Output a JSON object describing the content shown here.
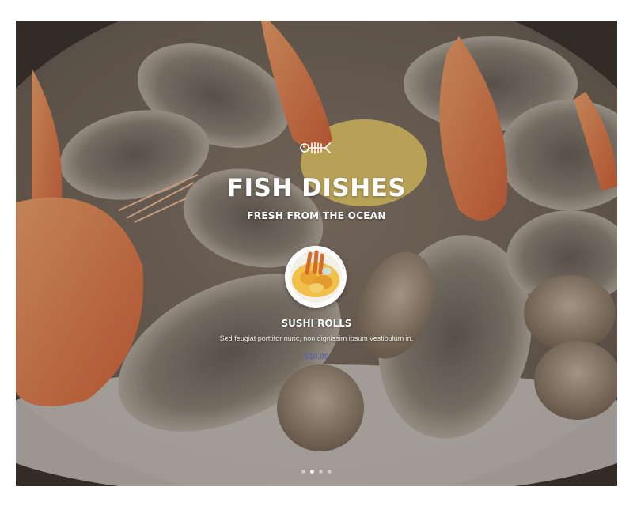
{
  "hero": {
    "title": "FISH DISHES",
    "subtitle": "FRESH FROM THE OCEAN",
    "icon": "fish-skeleton-icon"
  },
  "dish": {
    "name": "SUSHI ROLLS",
    "description": "Sed feugiat porttitor nunc, non dignissim ipsum vestibulum in.",
    "price": "$10.00",
    "image": "fried-seafood-plate"
  },
  "slider": {
    "slide_count": 4,
    "active_index": 1
  },
  "colors": {
    "price": "#5f64ae",
    "text": "#ffffff"
  }
}
